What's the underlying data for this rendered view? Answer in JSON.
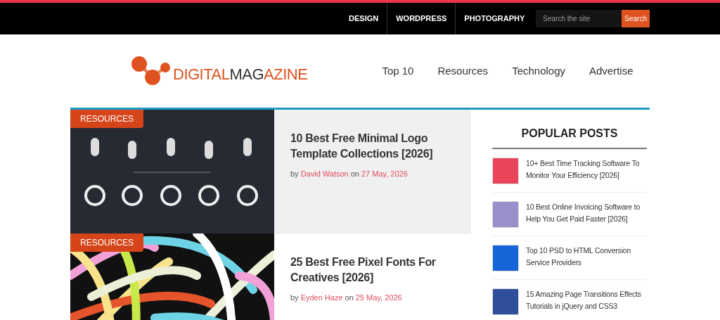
{
  "topbar": {
    "links": [
      "DESIGN",
      "WORDPRESS",
      "PHOTOGRAPHY"
    ],
    "search": {
      "placeholder": "Search the site",
      "button": "Search"
    }
  },
  "logo": {
    "parts": [
      {
        "text": "DIGITAL",
        "color": "#e0521f"
      },
      {
        "text": "MAG",
        "color": "#333333"
      },
      {
        "text": "AZINE",
        "color": "#e0521f"
      }
    ]
  },
  "nav": [
    "Top 10",
    "Resources",
    "Technology",
    "Advertise"
  ],
  "posts": [
    {
      "category": "RESOURCES",
      "title": "10 Best Free Minimal Logo Template Collections [2026]",
      "author": "David Watson",
      "date": "27 May, 2026",
      "by_label": "by",
      "on_label": "on",
      "highlighted": true
    },
    {
      "category": "RESOURCES",
      "title": "25 Best Free Pixel Fonts For Creatives [2026]",
      "author": "Eyden Haze",
      "date": "25 May, 2026",
      "by_label": "by",
      "on_label": "on",
      "highlighted": false
    }
  ],
  "sidebar": {
    "title": "POPULAR POSTS",
    "items": [
      {
        "title": "10+ Best Time Tracking Software To Monitor Your Efficiency [2026]",
        "color": "#e9455b"
      },
      {
        "title": "10 Best Online Invoicing Software to Help You Get Paid Faster [2026]",
        "color": "#9b8fc9"
      },
      {
        "title": "Top 10 PSD to HTML Conversion Service Providers",
        "color": "#1565d8"
      },
      {
        "title": "15 Amazing Page Transitions Effects Tutorials in jQuery and CSS3",
        "color": "#2f4f9a"
      }
    ]
  }
}
